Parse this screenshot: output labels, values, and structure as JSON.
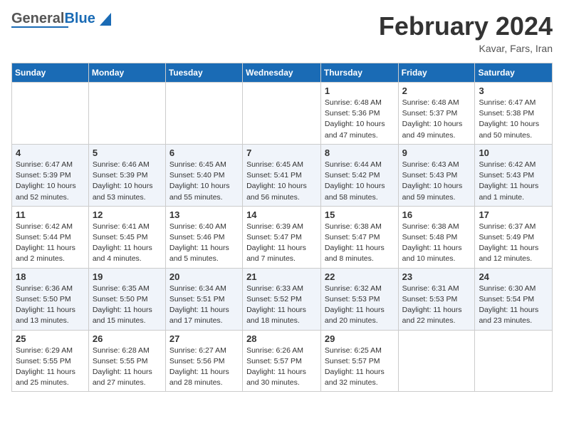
{
  "header": {
    "logo_general": "General",
    "logo_blue": "Blue",
    "month_title": "February 2024",
    "subtitle": "Kavar, Fars, Iran"
  },
  "calendar": {
    "days_of_week": [
      "Sunday",
      "Monday",
      "Tuesday",
      "Wednesday",
      "Thursday",
      "Friday",
      "Saturday"
    ],
    "weeks": [
      [
        {
          "day": "",
          "sunrise": "",
          "sunset": "",
          "daylight": ""
        },
        {
          "day": "",
          "sunrise": "",
          "sunset": "",
          "daylight": ""
        },
        {
          "day": "",
          "sunrise": "",
          "sunset": "",
          "daylight": ""
        },
        {
          "day": "",
          "sunrise": "",
          "sunset": "",
          "daylight": ""
        },
        {
          "day": "1",
          "sunrise": "Sunrise: 6:48 AM",
          "sunset": "Sunset: 5:36 PM",
          "daylight": "Daylight: 10 hours and 47 minutes."
        },
        {
          "day": "2",
          "sunrise": "Sunrise: 6:48 AM",
          "sunset": "Sunset: 5:37 PM",
          "daylight": "Daylight: 10 hours and 49 minutes."
        },
        {
          "day": "3",
          "sunrise": "Sunrise: 6:47 AM",
          "sunset": "Sunset: 5:38 PM",
          "daylight": "Daylight: 10 hours and 50 minutes."
        }
      ],
      [
        {
          "day": "4",
          "sunrise": "Sunrise: 6:47 AM",
          "sunset": "Sunset: 5:39 PM",
          "daylight": "Daylight: 10 hours and 52 minutes."
        },
        {
          "day": "5",
          "sunrise": "Sunrise: 6:46 AM",
          "sunset": "Sunset: 5:39 PM",
          "daylight": "Daylight: 10 hours and 53 minutes."
        },
        {
          "day": "6",
          "sunrise": "Sunrise: 6:45 AM",
          "sunset": "Sunset: 5:40 PM",
          "daylight": "Daylight: 10 hours and 55 minutes."
        },
        {
          "day": "7",
          "sunrise": "Sunrise: 6:45 AM",
          "sunset": "Sunset: 5:41 PM",
          "daylight": "Daylight: 10 hours and 56 minutes."
        },
        {
          "day": "8",
          "sunrise": "Sunrise: 6:44 AM",
          "sunset": "Sunset: 5:42 PM",
          "daylight": "Daylight: 10 hours and 58 minutes."
        },
        {
          "day": "9",
          "sunrise": "Sunrise: 6:43 AM",
          "sunset": "Sunset: 5:43 PM",
          "daylight": "Daylight: 10 hours and 59 minutes."
        },
        {
          "day": "10",
          "sunrise": "Sunrise: 6:42 AM",
          "sunset": "Sunset: 5:43 PM",
          "daylight": "Daylight: 11 hours and 1 minute."
        }
      ],
      [
        {
          "day": "11",
          "sunrise": "Sunrise: 6:42 AM",
          "sunset": "Sunset: 5:44 PM",
          "daylight": "Daylight: 11 hours and 2 minutes."
        },
        {
          "day": "12",
          "sunrise": "Sunrise: 6:41 AM",
          "sunset": "Sunset: 5:45 PM",
          "daylight": "Daylight: 11 hours and 4 minutes."
        },
        {
          "day": "13",
          "sunrise": "Sunrise: 6:40 AM",
          "sunset": "Sunset: 5:46 PM",
          "daylight": "Daylight: 11 hours and 5 minutes."
        },
        {
          "day": "14",
          "sunrise": "Sunrise: 6:39 AM",
          "sunset": "Sunset: 5:47 PM",
          "daylight": "Daylight: 11 hours and 7 minutes."
        },
        {
          "day": "15",
          "sunrise": "Sunrise: 6:38 AM",
          "sunset": "Sunset: 5:47 PM",
          "daylight": "Daylight: 11 hours and 8 minutes."
        },
        {
          "day": "16",
          "sunrise": "Sunrise: 6:38 AM",
          "sunset": "Sunset: 5:48 PM",
          "daylight": "Daylight: 11 hours and 10 minutes."
        },
        {
          "day": "17",
          "sunrise": "Sunrise: 6:37 AM",
          "sunset": "Sunset: 5:49 PM",
          "daylight": "Daylight: 11 hours and 12 minutes."
        }
      ],
      [
        {
          "day": "18",
          "sunrise": "Sunrise: 6:36 AM",
          "sunset": "Sunset: 5:50 PM",
          "daylight": "Daylight: 11 hours and 13 minutes."
        },
        {
          "day": "19",
          "sunrise": "Sunrise: 6:35 AM",
          "sunset": "Sunset: 5:50 PM",
          "daylight": "Daylight: 11 hours and 15 minutes."
        },
        {
          "day": "20",
          "sunrise": "Sunrise: 6:34 AM",
          "sunset": "Sunset: 5:51 PM",
          "daylight": "Daylight: 11 hours and 17 minutes."
        },
        {
          "day": "21",
          "sunrise": "Sunrise: 6:33 AM",
          "sunset": "Sunset: 5:52 PM",
          "daylight": "Daylight: 11 hours and 18 minutes."
        },
        {
          "day": "22",
          "sunrise": "Sunrise: 6:32 AM",
          "sunset": "Sunset: 5:53 PM",
          "daylight": "Daylight: 11 hours and 20 minutes."
        },
        {
          "day": "23",
          "sunrise": "Sunrise: 6:31 AM",
          "sunset": "Sunset: 5:53 PM",
          "daylight": "Daylight: 11 hours and 22 minutes."
        },
        {
          "day": "24",
          "sunrise": "Sunrise: 6:30 AM",
          "sunset": "Sunset: 5:54 PM",
          "daylight": "Daylight: 11 hours and 23 minutes."
        }
      ],
      [
        {
          "day": "25",
          "sunrise": "Sunrise: 6:29 AM",
          "sunset": "Sunset: 5:55 PM",
          "daylight": "Daylight: 11 hours and 25 minutes."
        },
        {
          "day": "26",
          "sunrise": "Sunrise: 6:28 AM",
          "sunset": "Sunset: 5:55 PM",
          "daylight": "Daylight: 11 hours and 27 minutes."
        },
        {
          "day": "27",
          "sunrise": "Sunrise: 6:27 AM",
          "sunset": "Sunset: 5:56 PM",
          "daylight": "Daylight: 11 hours and 28 minutes."
        },
        {
          "day": "28",
          "sunrise": "Sunrise: 6:26 AM",
          "sunset": "Sunset: 5:57 PM",
          "daylight": "Daylight: 11 hours and 30 minutes."
        },
        {
          "day": "29",
          "sunrise": "Sunrise: 6:25 AM",
          "sunset": "Sunset: 5:57 PM",
          "daylight": "Daylight: 11 hours and 32 minutes."
        },
        {
          "day": "",
          "sunrise": "",
          "sunset": "",
          "daylight": ""
        },
        {
          "day": "",
          "sunrise": "",
          "sunset": "",
          "daylight": ""
        }
      ]
    ]
  }
}
